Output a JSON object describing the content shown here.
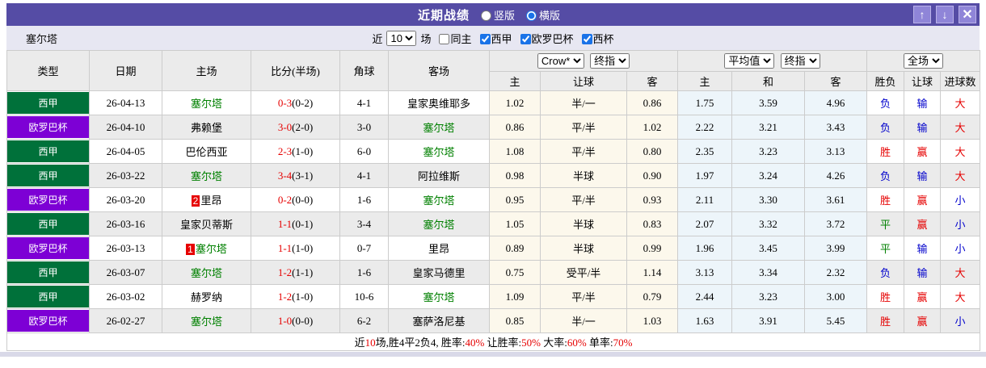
{
  "theme": {
    "titlebar_bg": "#554CA5",
    "laliga_green": "#00713A",
    "europa_purple": "#7D00D5",
    "win_red": "#E60000",
    "lose_blue": "#0000CC",
    "draw_green": "#008000"
  },
  "titlebar": {
    "title": "近期战绩",
    "layout_options": [
      {
        "label": "竖版",
        "checked": false
      },
      {
        "label": "横版",
        "checked": true
      }
    ],
    "up_icon": "↑",
    "down_icon": "↓",
    "close_icon": "✕"
  },
  "filterbar": {
    "team_name": "塞尔塔",
    "recent_prefix": "近",
    "recent_count": "10",
    "recent_suffix": "场",
    "same_home": {
      "label": "同主",
      "checked": false
    },
    "competitions": [
      {
        "label": "西甲",
        "checked": true
      },
      {
        "label": "欧罗巴杯",
        "checked": true
      },
      {
        "label": "西杯",
        "checked": true
      }
    ]
  },
  "table": {
    "left_headers": [
      "类型",
      "日期",
      "主场",
      "比分(半场)",
      "角球",
      "客场"
    ],
    "odds_groups": [
      {
        "selects": [
          "Crow*",
          "终指"
        ],
        "columns": [
          "主",
          "让球",
          "客"
        ]
      },
      {
        "selects": [
          "平均值",
          "终指"
        ],
        "columns": [
          "主",
          "和",
          "客"
        ]
      },
      {
        "selects": [
          "全场"
        ],
        "columns": [
          "胜负",
          "让球",
          "进球数"
        ]
      }
    ],
    "rows": [
      {
        "competition": "西甲",
        "competition_color": "#00713A",
        "date": "26-04-13",
        "home_rank": "",
        "home_team": "塞尔塔",
        "home_color": "#008000",
        "score": "0-3",
        "half_score": "(0-2)",
        "corners": "4-1",
        "away_team": "皇家奥维耶多",
        "away_color": "#000000",
        "odds": {
          "crow_home": "1.02",
          "handicap": "半/一",
          "crow_away": "0.86",
          "avg_home": "1.75",
          "avg_draw": "3.59",
          "avg_away": "4.96"
        },
        "results": {
          "wdl": "负",
          "wdl_color": "#0000CC",
          "handicap": "输",
          "handicap_color": "#0000CC",
          "goals": "大",
          "goals_color": "#E60000"
        }
      },
      {
        "competition": "欧罗巴杯",
        "competition_color": "#7D00D5",
        "date": "26-04-10",
        "home_rank": "",
        "home_team": "弗赖堡",
        "home_color": "#000000",
        "score": "3-0",
        "half_score": "(2-0)",
        "corners": "3-0",
        "away_team": "塞尔塔",
        "away_color": "#008000",
        "odds": {
          "crow_home": "0.86",
          "handicap": "平/半",
          "crow_away": "1.02",
          "avg_home": "2.22",
          "avg_draw": "3.21",
          "avg_away": "3.43"
        },
        "results": {
          "wdl": "负",
          "wdl_color": "#0000CC",
          "handicap": "输",
          "handicap_color": "#0000CC",
          "goals": "大",
          "goals_color": "#E60000"
        }
      },
      {
        "competition": "西甲",
        "competition_color": "#00713A",
        "date": "26-04-05",
        "home_rank": "",
        "home_team": "巴伦西亚",
        "home_color": "#000000",
        "score": "2-3",
        "half_score": "(1-0)",
        "corners": "6-0",
        "away_team": "塞尔塔",
        "away_color": "#008000",
        "odds": {
          "crow_home": "1.08",
          "handicap": "平/半",
          "crow_away": "0.80",
          "avg_home": "2.35",
          "avg_draw": "3.23",
          "avg_away": "3.13"
        },
        "results": {
          "wdl": "胜",
          "wdl_color": "#E60000",
          "handicap": "赢",
          "handicap_color": "#E60000",
          "goals": "大",
          "goals_color": "#E60000"
        }
      },
      {
        "competition": "西甲",
        "competition_color": "#00713A",
        "date": "26-03-22",
        "home_rank": "",
        "home_team": "塞尔塔",
        "home_color": "#008000",
        "score": "3-4",
        "half_score": "(3-1)",
        "corners": "4-1",
        "away_team": "阿拉维斯",
        "away_color": "#000000",
        "odds": {
          "crow_home": "0.98",
          "handicap": "半球",
          "crow_away": "0.90",
          "avg_home": "1.97",
          "avg_draw": "3.24",
          "avg_away": "4.26"
        },
        "results": {
          "wdl": "负",
          "wdl_color": "#0000CC",
          "handicap": "输",
          "handicap_color": "#0000CC",
          "goals": "大",
          "goals_color": "#E60000"
        }
      },
      {
        "competition": "欧罗巴杯",
        "competition_color": "#7D00D5",
        "date": "26-03-20",
        "home_rank": "2",
        "home_team": "里昂",
        "home_color": "#000000",
        "score": "0-2",
        "half_score": "(0-0)",
        "corners": "1-6",
        "away_team": "塞尔塔",
        "away_color": "#008000",
        "odds": {
          "crow_home": "0.95",
          "handicap": "平/半",
          "crow_away": "0.93",
          "avg_home": "2.11",
          "avg_draw": "3.30",
          "avg_away": "3.61"
        },
        "results": {
          "wdl": "胜",
          "wdl_color": "#E60000",
          "handicap": "赢",
          "handicap_color": "#E60000",
          "goals": "小",
          "goals_color": "#0000CC"
        }
      },
      {
        "competition": "西甲",
        "competition_color": "#00713A",
        "date": "26-03-16",
        "home_rank": "",
        "home_team": "皇家贝蒂斯",
        "home_color": "#000000",
        "score": "1-1",
        "half_score": "(0-1)",
        "corners": "3-4",
        "away_team": "塞尔塔",
        "away_color": "#008000",
        "odds": {
          "crow_home": "1.05",
          "handicap": "半球",
          "crow_away": "0.83",
          "avg_home": "2.07",
          "avg_draw": "3.32",
          "avg_away": "3.72"
        },
        "results": {
          "wdl": "平",
          "wdl_color": "#008000",
          "handicap": "赢",
          "handicap_color": "#E60000",
          "goals": "小",
          "goals_color": "#0000CC"
        }
      },
      {
        "competition": "欧罗巴杯",
        "competition_color": "#7D00D5",
        "date": "26-03-13",
        "home_rank": "1",
        "home_team": "塞尔塔",
        "home_color": "#008000",
        "score": "1-1",
        "half_score": "(1-0)",
        "corners": "0-7",
        "away_team": "里昂",
        "away_color": "#000000",
        "odds": {
          "crow_home": "0.89",
          "handicap": "半球",
          "crow_away": "0.99",
          "avg_home": "1.96",
          "avg_draw": "3.45",
          "avg_away": "3.99"
        },
        "results": {
          "wdl": "平",
          "wdl_color": "#008000",
          "handicap": "输",
          "handicap_color": "#0000CC",
          "goals": "小",
          "goals_color": "#0000CC"
        }
      },
      {
        "competition": "西甲",
        "competition_color": "#00713A",
        "date": "26-03-07",
        "home_rank": "",
        "home_team": "塞尔塔",
        "home_color": "#008000",
        "score": "1-2",
        "half_score": "(1-1)",
        "corners": "1-6",
        "away_team": "皇家马德里",
        "away_color": "#000000",
        "odds": {
          "crow_home": "0.75",
          "handicap": "受平/半",
          "crow_away": "1.14",
          "avg_home": "3.13",
          "avg_draw": "3.34",
          "avg_away": "2.32"
        },
        "results": {
          "wdl": "负",
          "wdl_color": "#0000CC",
          "handicap": "输",
          "handicap_color": "#0000CC",
          "goals": "大",
          "goals_color": "#E60000"
        }
      },
      {
        "competition": "西甲",
        "competition_color": "#00713A",
        "date": "26-03-02",
        "home_rank": "",
        "home_team": "赫罗纳",
        "home_color": "#000000",
        "score": "1-2",
        "half_score": "(1-0)",
        "corners": "10-6",
        "away_team": "塞尔塔",
        "away_color": "#008000",
        "odds": {
          "crow_home": "1.09",
          "handicap": "平/半",
          "crow_away": "0.79",
          "avg_home": "2.44",
          "avg_draw": "3.23",
          "avg_away": "3.00"
        },
        "results": {
          "wdl": "胜",
          "wdl_color": "#E60000",
          "handicap": "赢",
          "handicap_color": "#E60000",
          "goals": "大",
          "goals_color": "#E60000"
        }
      },
      {
        "competition": "欧罗巴杯",
        "competition_color": "#7D00D5",
        "date": "26-02-27",
        "home_rank": "",
        "home_team": "塞尔塔",
        "home_color": "#008000",
        "score": "1-0",
        "half_score": "(0-0)",
        "corners": "6-2",
        "away_team": "塞萨洛尼基",
        "away_color": "#000000",
        "odds": {
          "crow_home": "0.85",
          "handicap": "半/一",
          "crow_away": "1.03",
          "avg_home": "1.63",
          "avg_draw": "3.91",
          "avg_away": "5.45"
        },
        "results": {
          "wdl": "胜",
          "wdl_color": "#E60000",
          "handicap": "赢",
          "handicap_color": "#E60000",
          "goals": "小",
          "goals_color": "#0000CC"
        }
      }
    ]
  },
  "footer": {
    "segments": [
      {
        "text": "近",
        "color": "#000000"
      },
      {
        "text": "10",
        "color": "#E60000"
      },
      {
        "text": "场,胜4平2负4, 胜率:",
        "color": "#000000"
      },
      {
        "text": "40%",
        "color": "#E60000"
      },
      {
        "text": " 让胜率:",
        "color": "#000000"
      },
      {
        "text": "50%",
        "color": "#E60000"
      },
      {
        "text": " 大率:",
        "color": "#000000"
      },
      {
        "text": "60%",
        "color": "#E60000"
      },
      {
        "text": " 单率:",
        "color": "#000000"
      },
      {
        "text": "70%",
        "color": "#E60000"
      }
    ]
  }
}
